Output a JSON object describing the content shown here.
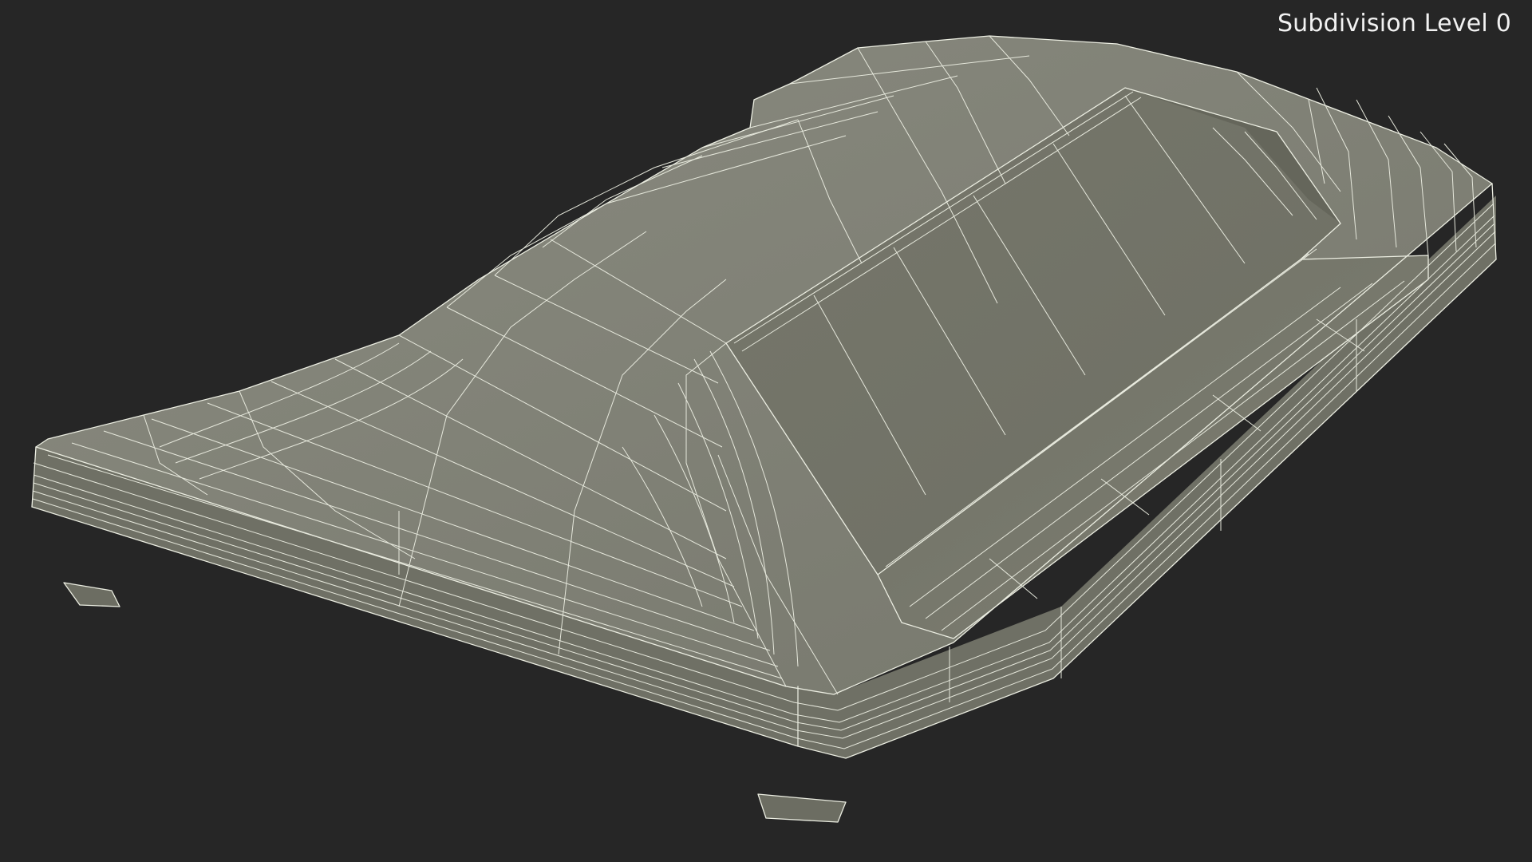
{
  "viewport": {
    "label": "Subdivision Level 0",
    "background_color": "#262626",
    "surface_color": "#7a7b6f",
    "wire_color": "#eceee2"
  },
  "model": {
    "render_mode": "wireframe-on-shaded"
  }
}
